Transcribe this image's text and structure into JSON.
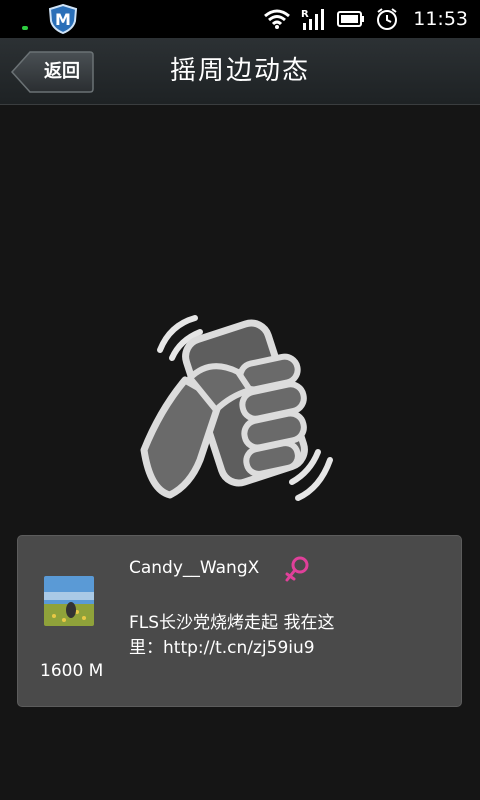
{
  "status_bar": {
    "time": "11:53",
    "icons": [
      "notification-led",
      "shield-m-icon",
      "wifi-icon",
      "signal-icon",
      "battery-icon",
      "alarm-clock-icon"
    ],
    "shield_letter": "M"
  },
  "header": {
    "back_label": "返回",
    "title": "摇周边动态"
  },
  "main": {
    "shake_icon": "hand-shaking-phone-icon"
  },
  "result_card": {
    "username": "Candy__WangX",
    "gender": "female",
    "gender_symbol": "♀",
    "status_line1": "FLS长沙党烧烤走起 我在这",
    "status_line2": "里：http://t.cn/zj59iu9",
    "distance": "1600 M"
  },
  "colors": {
    "background": "#151515",
    "card": "#4a4a4a",
    "gender_accent": "#e0409a"
  }
}
